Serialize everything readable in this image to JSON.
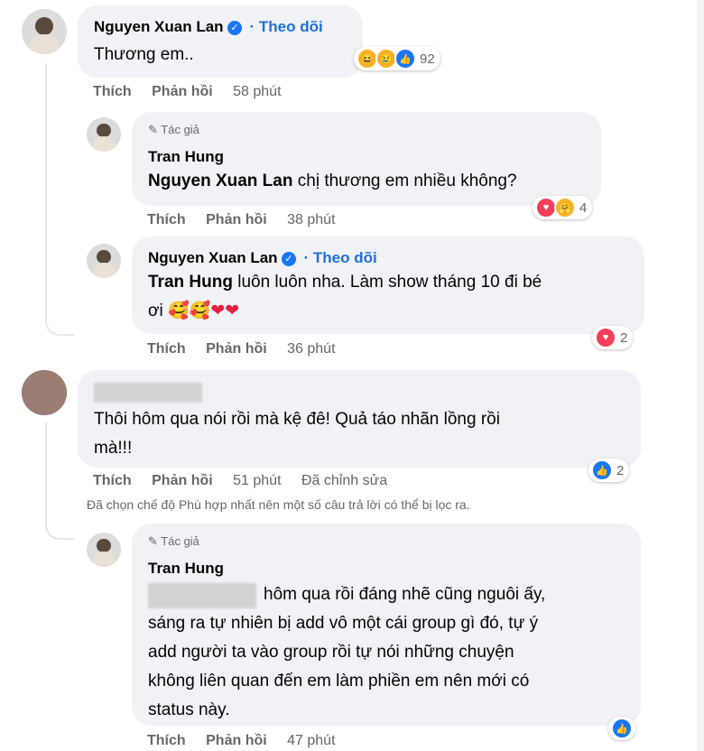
{
  "colors": {
    "accent": "#216fdb",
    "bubble": "#f0f2f5",
    "meta": "#65676b",
    "like": "#1877f2",
    "love": "#f33e58"
  },
  "actions": {
    "like": "Thích",
    "reply": "Phản hồi"
  },
  "author_badge": "Tác giả",
  "follow_label": "Theo dõi",
  "comments": [
    {
      "name": "Nguyen Xuan Lan",
      "verified": true,
      "text": "Thương em..",
      "reactions": [
        "haha-icon",
        "sad-icon",
        "like-icon"
      ],
      "reaction_count": "92",
      "time": "58 phút"
    },
    {
      "name": "Tran Hung",
      "author": true,
      "mention": "Nguyen Xuan Lan",
      "text": "chị thương em nhiều không?",
      "reactions": [
        "love-icon",
        "care-icon"
      ],
      "reaction_count": "4",
      "time": "38 phút"
    },
    {
      "name": "Nguyen Xuan Lan",
      "verified": true,
      "mention": "Tran Hung",
      "text_line1": "luôn luôn nha. Làm show tháng 10 đi bé",
      "text_line2": "ơi",
      "emoji": [
        "smiling-hearts-icon",
        "smiling-hearts-icon",
        "red-heart-icon",
        "red-heart-icon"
      ],
      "reactions": [
        "love-icon"
      ],
      "reaction_count": "2",
      "time": "36 phút"
    },
    {
      "name_redacted": true,
      "text_line1": "Thôi hôm qua nói rồi mà kệ đê! Quả táo nhãn lồng rồi",
      "text_line2": "mà!!!",
      "reactions": [
        "like-icon"
      ],
      "reaction_count": "2",
      "time": "51 phút",
      "edited": "Đã chỉnh sửa"
    },
    {
      "name": "Tran Hung",
      "author": true,
      "lines": [
        "hôm qua rồi đáng nhẽ cũng nguôi ấy,",
        "sáng ra tự nhiên bị add vô một cái group gì đó, tự ý",
        "add người ta vào group rồi tự nói những chuyện",
        "không liên quan đến em làm phiền em nên mới có",
        "status này."
      ],
      "reactions": [
        "like-icon"
      ],
      "time": "47 phút"
    }
  ],
  "filter_notice": "Đã chọn chế độ Phù hợp nhất nên một số câu trả lời có thể bị lọc ra."
}
